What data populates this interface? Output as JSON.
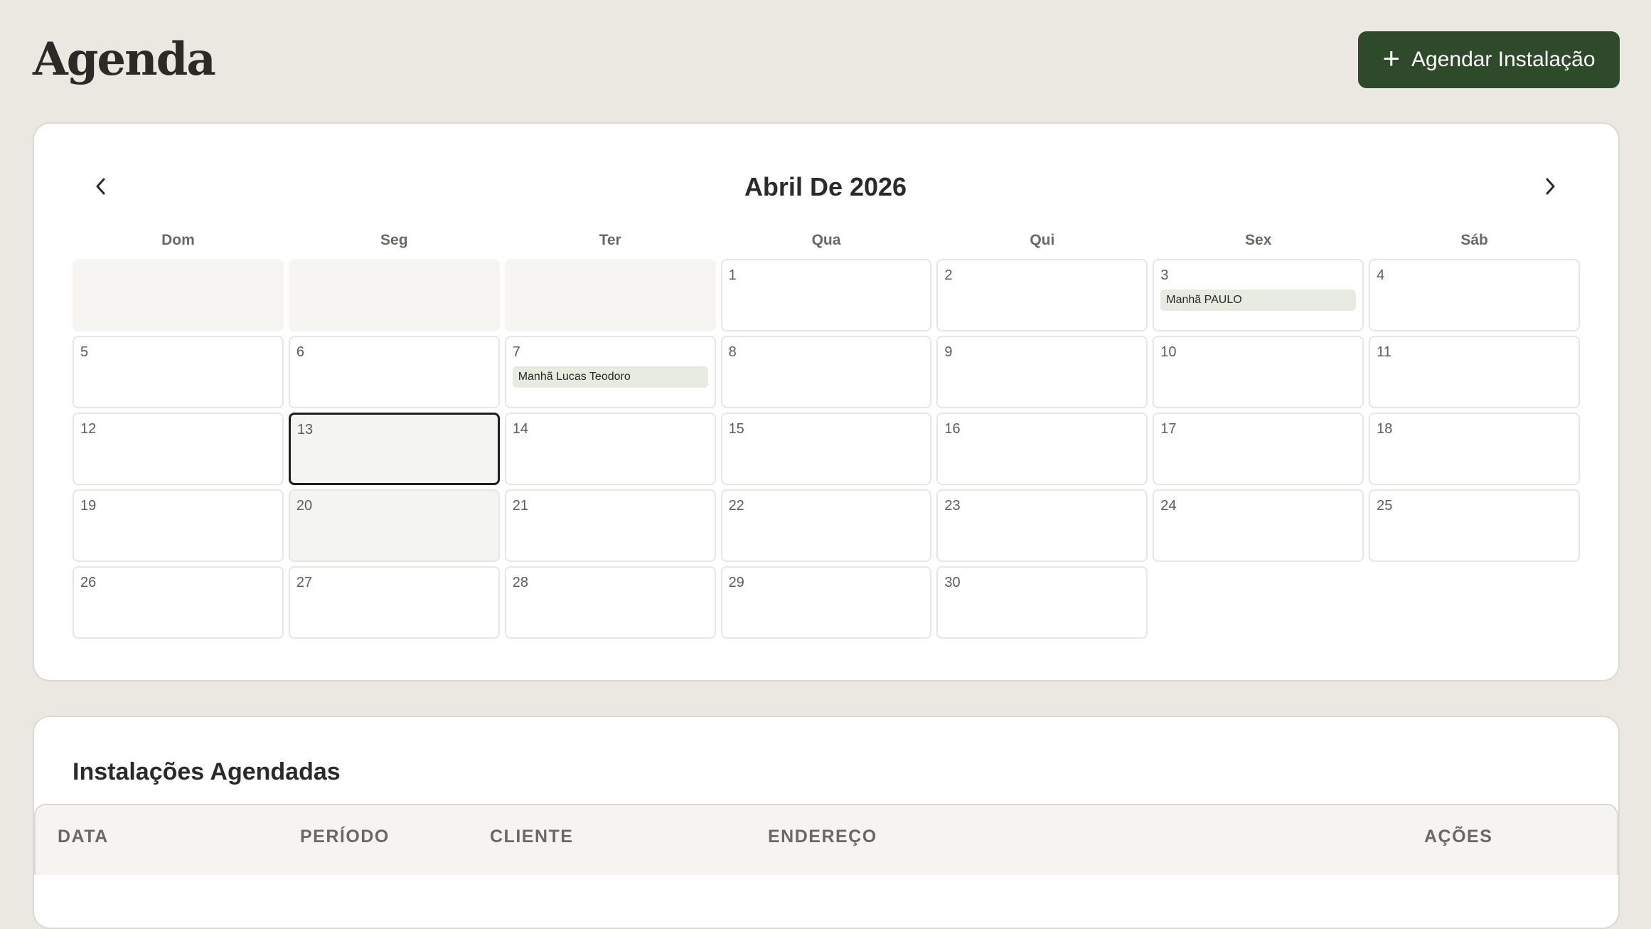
{
  "header": {
    "title": "Agenda",
    "add_button_label": "Agendar Instalação",
    "add_button_icon": "plus-icon"
  },
  "calendar": {
    "month_title": "Abril De 2026",
    "prev_icon": "chevron-left-icon",
    "next_icon": "chevron-right-icon",
    "weekdays": [
      "Dom",
      "Seg",
      "Ter",
      "Qua",
      "Qui",
      "Sex",
      "Sáb"
    ],
    "leading_empty_days": 3,
    "days_in_month": 30,
    "today": 13,
    "highlighted_days": [
      20
    ],
    "events": [
      {
        "day": 3,
        "label": "Manhã PAULO"
      },
      {
        "day": 7,
        "label": "Manhã Lucas Teodoro"
      }
    ]
  },
  "scheduled": {
    "title": "Instalações Agendadas",
    "columns": [
      "DATA",
      "PERÍODO",
      "CLIENTE",
      "ENDEREÇO",
      "AÇÕES"
    ]
  },
  "colors": {
    "primary": "#2e4a2b",
    "background": "#ebe8e2",
    "event_bg": "#e7eadf"
  }
}
